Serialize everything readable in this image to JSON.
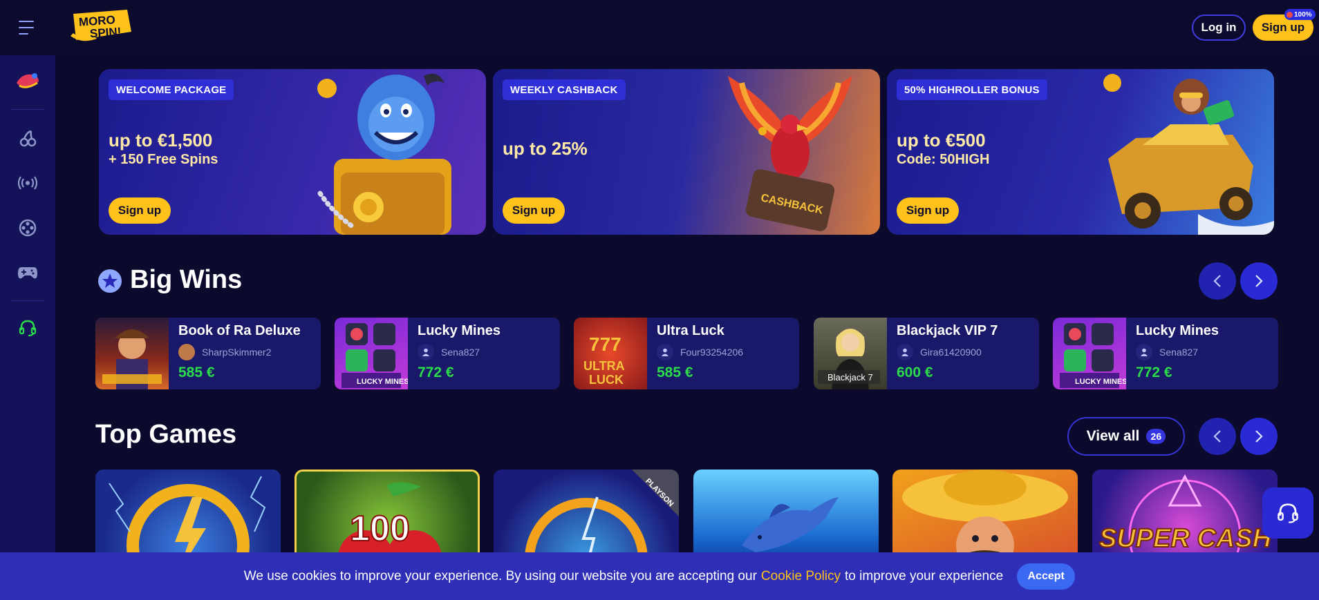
{
  "header": {
    "logo_text_line1": "MORO",
    "logo_text_line2": "SPIN!",
    "login_label": "Log in",
    "signup_label": "Sign up",
    "signup_badge": "100%"
  },
  "banners": [
    {
      "tag": "WELCOME PACKAGE",
      "headline": "up to €1,500",
      "sub": "+ 150 Free Spins",
      "button": "Sign up"
    },
    {
      "tag": "WEEKLY CASHBACK",
      "headline": "up to 25%",
      "sub": "",
      "button": "Sign up"
    },
    {
      "tag": "50% HIGHROLLER BONUS",
      "headline": "up to €500",
      "sub": "Code: 50HIGH",
      "button": "Sign up"
    }
  ],
  "big_wins": {
    "title": "Big Wins",
    "items": [
      {
        "game": "Book of Ra Deluxe",
        "user": "SharpSkimmer2",
        "amount": "585 €"
      },
      {
        "game": "Lucky Mines",
        "user": "Sena827",
        "amount": "772 €"
      },
      {
        "game": "Ultra Luck",
        "user": "Four93254206",
        "amount": "585 €"
      },
      {
        "game": "Blackjack VIP 7",
        "user": "Gira61420900",
        "amount": "600 €"
      },
      {
        "game": "Lucky Mines",
        "user": "Sena827",
        "amount": "772 €"
      }
    ]
  },
  "top_games": {
    "title": "Top Games",
    "view_all_label": "View all",
    "view_all_count": "26",
    "tiles": [
      {
        "art_text": ""
      },
      {
        "art_text": "100"
      },
      {
        "art_text": "PLAYSON"
      },
      {
        "art_text": ""
      },
      {
        "art_text": ""
      },
      {
        "art_text": "SUPER CASH"
      }
    ]
  },
  "cookie": {
    "text_before": "We use cookies to improve your experience. By using our website you are accepting our",
    "link": "Cookie Policy",
    "text_after": "to improve your experience",
    "accept_label": "Accept"
  },
  "colors": {
    "background": "#0b0a2c",
    "sidebar": "#141259",
    "accent_yellow": "#ffc21a",
    "accent_blue": "#2f2fd8",
    "win_green": "#2bdc4a"
  },
  "icons": {
    "menu": "hamburger-icon",
    "sidebar": [
      "magic-carpet-icon",
      "cherries-icon",
      "live-broadcast-icon",
      "film-reel-icon",
      "gamepad-icon",
      "headset-icon"
    ],
    "section": "star-icon",
    "arrows": [
      "chevron-left-icon",
      "chevron-right-icon"
    ]
  }
}
